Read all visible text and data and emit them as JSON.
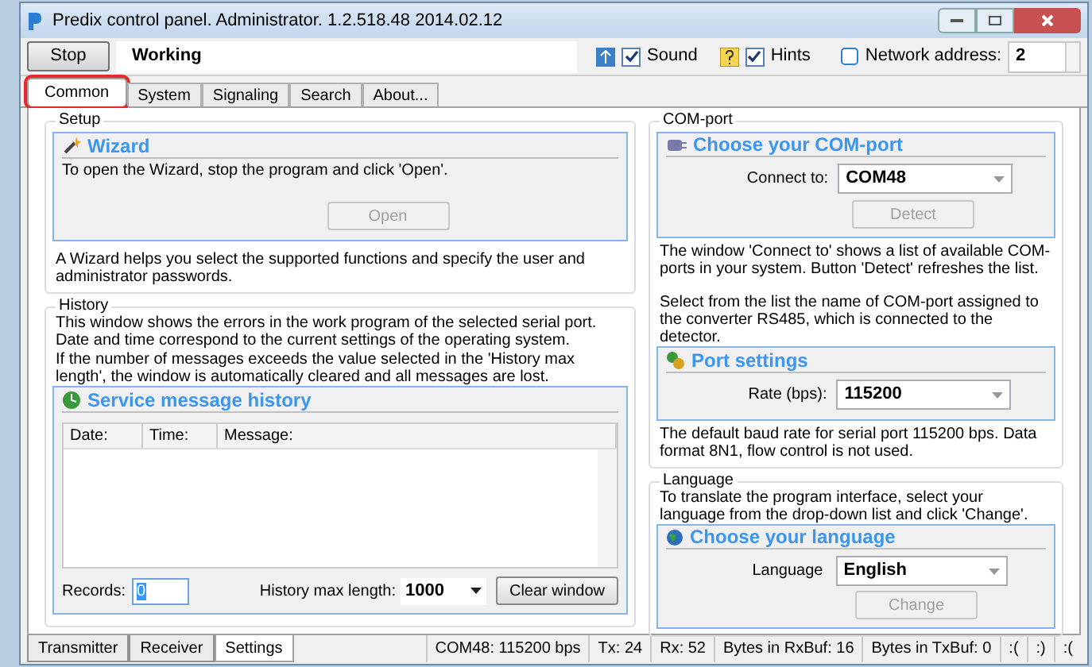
{
  "window": {
    "title": "Predix control panel. Administrator. 1.2.518.48 2014.02.12"
  },
  "toolbar": {
    "stop_button": "Stop",
    "status": "Working",
    "sound": {
      "label": "Sound",
      "checked": true
    },
    "hints": {
      "label": "Hints",
      "checked": true
    },
    "network_address": {
      "label": "Network address:",
      "value": "2"
    }
  },
  "tabs": [
    {
      "label": "Common",
      "selected": true,
      "highlighted": true
    },
    {
      "label": "System",
      "selected": false,
      "highlighted": false
    },
    {
      "label": "Signaling",
      "selected": false,
      "highlighted": false
    },
    {
      "label": "Search",
      "selected": false,
      "highlighted": false
    },
    {
      "label": "About...",
      "selected": false,
      "highlighted": false
    }
  ],
  "setup": {
    "legend": "Setup",
    "title": "Wizard",
    "text": "To open the Wizard, stop the program and click 'Open'.",
    "button": {
      "label": "Open",
      "disabled": true
    },
    "note": "A Wizard helps you select the supported functions and specify the user and administrator passwords."
  },
  "history": {
    "legend": "History",
    "text1": "This window shows the errors in the work program of the selected serial port. Date and time correspond to the current settings of the operating system.",
    "text2": "If the number of messages exceeds the value selected in the 'History max length', the window is automatically cleared and all messages are lost.",
    "title": "Service message history",
    "columns": [
      "Date:",
      "Time:",
      "Message:"
    ],
    "records_label": "Records:",
    "records_value": "0",
    "max_label": "History max length:",
    "max_value": "1000",
    "clear_button": "Clear window"
  },
  "com_port": {
    "legend": "COM-port",
    "title": "Choose your COM-port",
    "connect_label": "Connect to:",
    "connect_value": "COM48",
    "detect_button": {
      "label": "Detect",
      "disabled": true
    },
    "text1": "The window 'Connect to' shows a list of available COM-ports in your system. Button 'Detect' refreshes the list.",
    "text2": "Select from the list the name of COM-port assigned to the converter RS485, which is connected to the detector.",
    "port_title": "Port settings",
    "rate_label": "Rate (bps):",
    "rate_value": "115200",
    "text3": "The default baud rate for serial port 115200 bps. Data format 8N1, flow control is not used."
  },
  "language": {
    "legend": "Language",
    "text": "To translate the program interface, select your language from the drop-down list and click 'Change'.",
    "title": "Choose your language",
    "label": "Language",
    "value": "English",
    "button": {
      "label": "Change",
      "disabled": true
    }
  },
  "bottom_tabs": [
    {
      "label": "Transmitter",
      "selected": false
    },
    {
      "label": "Receiver",
      "selected": false
    },
    {
      "label": "Settings",
      "selected": true
    }
  ],
  "status_bar": [
    "COM48: 115200 bps",
    "Tx: 24",
    "Rx: 52",
    "Bytes in RxBuf: 16",
    "Bytes in TxBuf: 0",
    ":(",
    ":)",
    ":("
  ]
}
